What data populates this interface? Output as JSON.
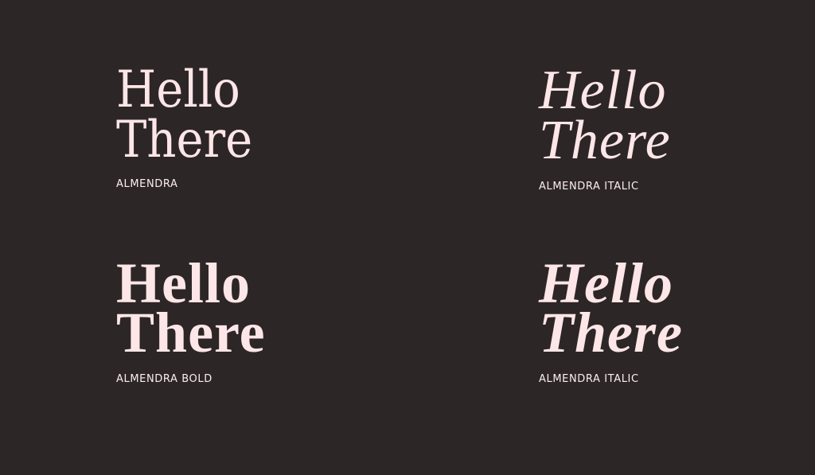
{
  "specimens": [
    {
      "headline_line1": "Hello",
      "headline_line2": "There",
      "caption": "ALMENDRA"
    },
    {
      "headline_line1": "Hello",
      "headline_line2": "There",
      "caption": "ALMENDRA ITALIC"
    },
    {
      "headline_line1": "Hello",
      "headline_line2": "There",
      "caption": "ALMENDRA BOLD"
    },
    {
      "headline_line1": "Hello",
      "headline_line2": "There",
      "caption": "ALMENDRA ITALIC"
    }
  ],
  "colors": {
    "background": "#2d2626",
    "headline": "#fde6e7",
    "caption": "#fbeef0"
  }
}
